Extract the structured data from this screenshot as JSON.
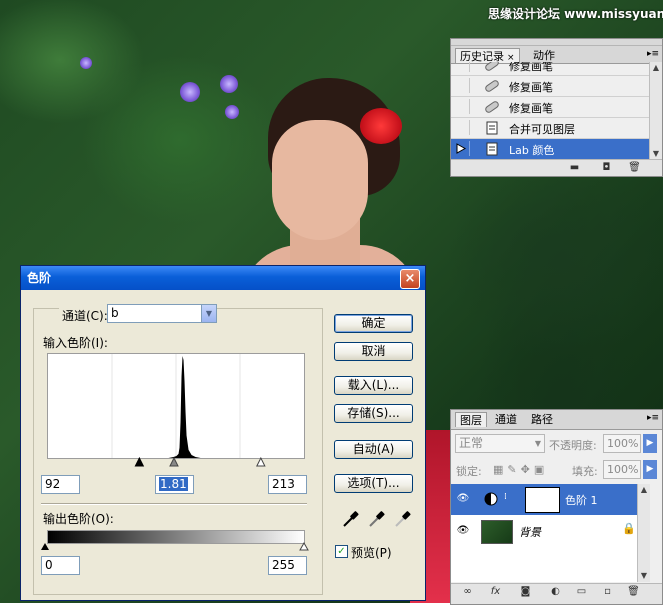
{
  "watermark": "思缘设计论坛 www.missyuan.com",
  "history_panel": {
    "tabs": [
      "历史记录",
      "动作"
    ],
    "close_glyph": "×",
    "menu_glyph": "▸≡",
    "items": [
      {
        "label": "修复画笔",
        "icon": "healing-brush-icon",
        "selected": false
      },
      {
        "label": "修复画笔",
        "icon": "healing-brush-icon",
        "selected": false
      },
      {
        "label": "修复画笔",
        "icon": "healing-brush-icon",
        "selected": false
      },
      {
        "label": "合并可见图层",
        "icon": "document-icon",
        "selected": false
      },
      {
        "label": "Lab 颜色",
        "icon": "document-icon",
        "selected": true
      }
    ]
  },
  "levels_dialog": {
    "title": "色阶",
    "close_glyph": "×",
    "channel_label": "通道(C):",
    "channel_value": "b",
    "input_label": "输入色阶(I):",
    "input_values": [
      "92",
      "1.81",
      "213"
    ],
    "output_label": "输出色阶(O):",
    "output_values": [
      "0",
      "255"
    ],
    "buttons": {
      "ok": "确定",
      "cancel": "取消",
      "load": "载入(L)...",
      "save": "存储(S)...",
      "auto": "自动(A)",
      "options": "选项(T)..."
    },
    "preview_label": "预览(P)",
    "preview_checked": true,
    "check_glyph": "✓",
    "dropdown_arrow": "▼"
  },
  "layers_panel": {
    "tabs": [
      "图层",
      "通道",
      "路径"
    ],
    "blend_mode": "正常",
    "opacity_label": "不透明度:",
    "opacity_value": "100%",
    "lock_label": "锁定:",
    "fill_label": "填充:",
    "fill_value": "100%",
    "eye_glyph": "👁",
    "layers": [
      {
        "name": "色阶 1",
        "selected": true,
        "type": "adjustment"
      },
      {
        "name": "背景",
        "selected": false,
        "type": "image",
        "locked": true
      }
    ],
    "footer_icons": [
      "link-icon",
      "fx-icon",
      "mask-icon",
      "adjustment-icon",
      "group-icon",
      "new-layer-icon",
      "trash-icon"
    ],
    "footer_glyphs": [
      "∞",
      "fx",
      "◙",
      "◐",
      "▭",
      "▫",
      "🗑"
    ]
  },
  "history_footer_glyphs": [
    "▬",
    "◘",
    "🗑"
  ],
  "chart_data": {
    "type": "area",
    "title": "",
    "xlabel": "",
    "ylabel": "",
    "xlim": [
      0,
      255
    ],
    "ylim": [
      0,
      100
    ],
    "x": [
      120,
      125,
      128,
      130,
      131,
      132,
      133,
      134,
      135,
      136,
      137,
      138,
      140,
      143,
      147,
      152
    ],
    "y": [
      0,
      1,
      2,
      4,
      10,
      35,
      80,
      100,
      96,
      75,
      45,
      22,
      8,
      3,
      1,
      0
    ]
  }
}
